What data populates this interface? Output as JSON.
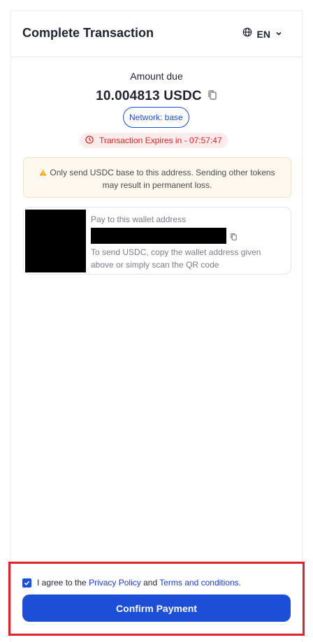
{
  "header": {
    "title": "Complete Transaction",
    "language": "EN",
    "language_icon": "globe-icon",
    "dropdown_icon": "chevron-down-icon"
  },
  "payment": {
    "amount_label": "Amount due",
    "amount_value": "10.004813 USDC",
    "copy_icon": "copy-icon",
    "network": "Network: base",
    "expires_text": "Transaction Expires in - 07:57:47",
    "expires_icon": "clock-icon"
  },
  "warning": {
    "icon": "warning-icon",
    "text": "Only send USDC base to this address. Sending other tokens may result in permanent loss."
  },
  "wallet": {
    "label": "Pay to this wallet address",
    "help": "To send USDC, copy the wallet address given above or simply scan the QR code",
    "copy_icon": "copy-icon"
  },
  "footer": {
    "agree_prefix": "I agree to the",
    "privacy_link": "Privacy Policy",
    "and_text": "and",
    "terms_link": "Terms and conditions.",
    "checkbox_checked": true,
    "confirm_label": "Confirm Payment"
  },
  "colors": {
    "primary": "#1d4ed8",
    "danger": "#dc2626",
    "warning_bg": "#fff8ef",
    "highlight_border": "#e0202a"
  }
}
